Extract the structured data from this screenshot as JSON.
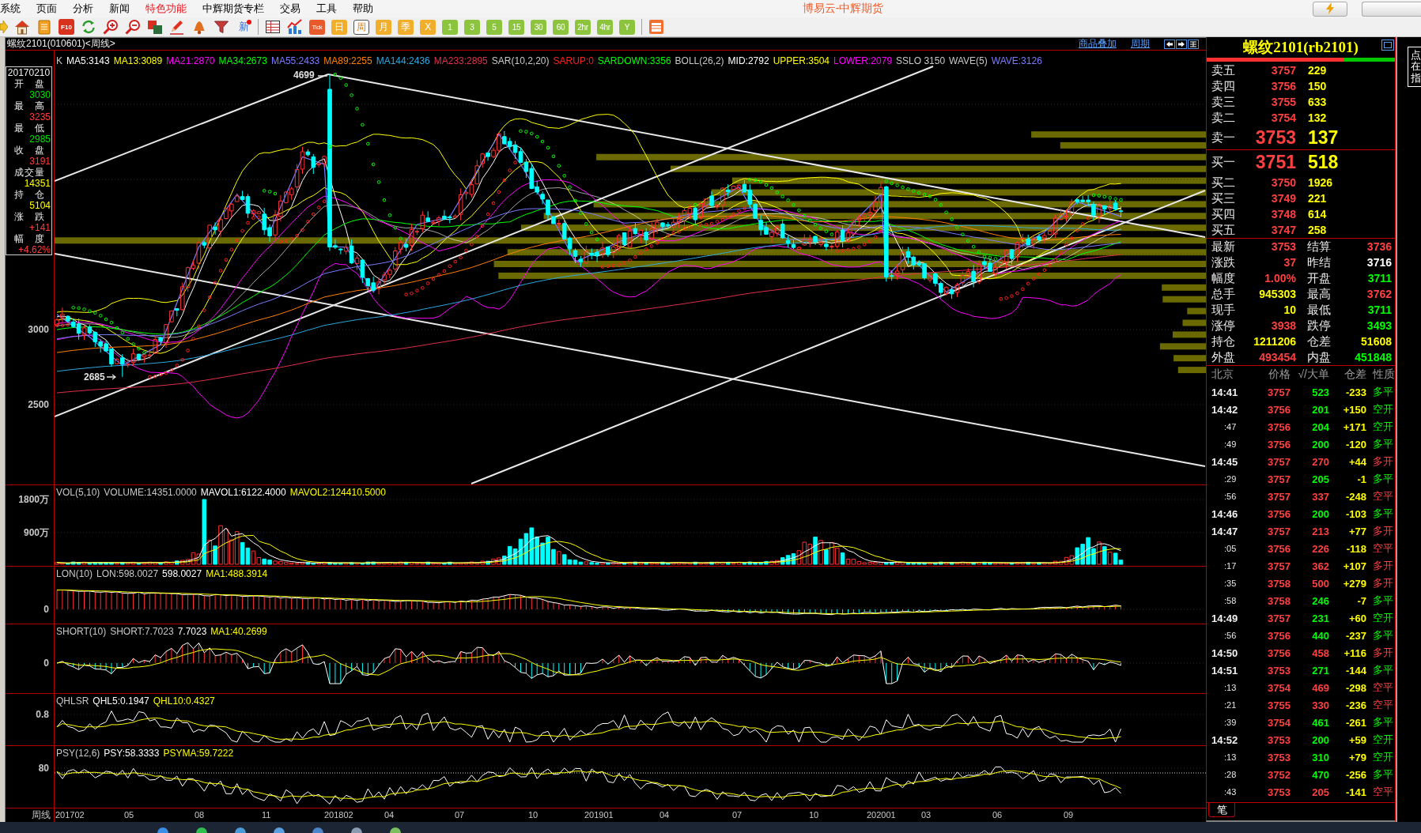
{
  "menu_bar": {
    "items": [
      {
        "label": "系统",
        "highlighted": false
      },
      {
        "label": "页面",
        "highlighted": false
      },
      {
        "label": "分析",
        "highlighted": false
      },
      {
        "label": "新闻",
        "highlighted": false
      },
      {
        "label": "特色功能",
        "highlighted": true
      },
      {
        "label": "中辉期货专栏",
        "highlighted": false
      },
      {
        "label": "交易",
        "highlighted": false
      },
      {
        "label": "工具",
        "highlighted": false
      },
      {
        "label": "帮助",
        "highlighted": false
      }
    ],
    "title": "博易云-中辉期货"
  },
  "toolbar": {
    "f10_label": "F10",
    "news_label": "新",
    "periods": [
      {
        "label": "Tick",
        "kind": "tick",
        "selected": false
      },
      {
        "label": "日",
        "kind": "calendar",
        "selected": false
      },
      {
        "label": "周",
        "kind": "calendar",
        "selected": true
      },
      {
        "label": "月",
        "kind": "calendar",
        "selected": false
      },
      {
        "label": "季",
        "kind": "calendar",
        "selected": false
      },
      {
        "label": "X",
        "kind": "calendar",
        "selected": false
      },
      {
        "label": "1",
        "kind": "minute",
        "selected": false
      },
      {
        "label": "3",
        "kind": "minute",
        "selected": false
      },
      {
        "label": "5",
        "kind": "minute",
        "selected": false
      },
      {
        "label": "15",
        "kind": "minute",
        "selected": false
      },
      {
        "label": "30",
        "kind": "minute",
        "selected": false
      },
      {
        "label": "60",
        "kind": "minute",
        "selected": false
      },
      {
        "label": "2hr",
        "kind": "minute",
        "selected": false
      },
      {
        "label": "4hr",
        "kind": "minute",
        "selected": false
      },
      {
        "label": "Y",
        "kind": "minute",
        "selected": false
      }
    ]
  },
  "chart_header": {
    "title": "螺纹2101(010601)<周线>",
    "links": [
      "商品叠加",
      "周期"
    ]
  },
  "main_chart": {
    "legend": [
      {
        "text": "K",
        "color": "#c8c8c8"
      },
      {
        "text": "MA5:3143",
        "color": "#ffffff"
      },
      {
        "text": "MA13:3089",
        "color": "#ffff00"
      },
      {
        "text": "MA21:2870",
        "color": "#ff00ff"
      },
      {
        "text": "MA34:2673",
        "color": "#00ff00"
      },
      {
        "text": "MA55:2433",
        "color": "#7b7bff"
      },
      {
        "text": "MA89:2255",
        "color": "#ff8000"
      },
      {
        "text": "MA144:2436",
        "color": "#2ea8e0"
      },
      {
        "text": "MA233:2895",
        "color": "#e0304a"
      },
      {
        "text": "SAR(10,2,20)",
        "color": "#c8c8c8"
      },
      {
        "text": "SARUP:0",
        "color": "#ff2020"
      },
      {
        "text": "SARDOWN:3356",
        "color": "#00ff00"
      },
      {
        "text": "BOLL(26,2)",
        "color": "#c8c8c8"
      },
      {
        "text": "MID:2792",
        "color": "#ffffff"
      },
      {
        "text": "UPPER:3504",
        "color": "#ffff00"
      },
      {
        "text": "LOWER:2079",
        "color": "#ff00ff"
      },
      {
        "text": "SSLO 3150",
        "color": "#c8c8c8"
      },
      {
        "text": "WAVE(5)",
        "color": "#c8c8c8"
      },
      {
        "text": "WAVE:3126",
        "color": "#7b7bff"
      }
    ],
    "y_labels": [
      "3000",
      "2500"
    ],
    "high_marker": "4699",
    "low_marker": "2685",
    "info_box": {
      "date": "20170210",
      "rows": [
        {
          "label": "开盘",
          "value": "3030",
          "color": "#00e000"
        },
        {
          "label": "最高",
          "value": "3235",
          "color": "#ff3c3c"
        },
        {
          "label": "最低",
          "value": "2985",
          "color": "#00e000"
        },
        {
          "label": "收盘",
          "value": "3191",
          "color": "#ff3c3c"
        },
        {
          "label": "成交量",
          "value": "14351",
          "color": "#ffff00"
        },
        {
          "label": "持仓",
          "value": "5104",
          "color": "#ffff00"
        },
        {
          "label": "涨跌",
          "value": "+141",
          "color": "#ff3c3c"
        },
        {
          "label": "幅度",
          "value": "+4.62%",
          "color": "#ff3c3c"
        }
      ]
    }
  },
  "indicator_panes": [
    {
      "kind": "volume",
      "legend": [
        {
          "text": "VOL(5,10)",
          "color": "#c8c8c8"
        },
        {
          "text": "VOLUME:14351.0000",
          "color": "#c8c8c8"
        },
        {
          "text": "MAVOL1:6122.4000",
          "color": "#ffffff"
        },
        {
          "text": "MAVOL2:124410.5000",
          "color": "#ffff00"
        }
      ],
      "y_labels": [
        "1800万",
        "900万"
      ]
    },
    {
      "kind": "lon",
      "legend": [
        {
          "text": "LON(10)",
          "color": "#c8c8c8"
        },
        {
          "text": "LON:598.0027",
          "color": "#c8c8c8"
        },
        {
          "text": "598.0027",
          "color": "#ffffff"
        },
        {
          "text": "MA1:488.3914",
          "color": "#ffff00"
        }
      ],
      "y_labels": [
        "0"
      ]
    },
    {
      "kind": "short",
      "legend": [
        {
          "text": "SHORT(10)",
          "color": "#c8c8c8"
        },
        {
          "text": "SHORT:7.7023",
          "color": "#c8c8c8"
        },
        {
          "text": "7.7023",
          "color": "#ffffff"
        },
        {
          "text": "MA1:40.2699",
          "color": "#ffff00"
        }
      ],
      "y_labels": [
        "0"
      ]
    },
    {
      "kind": "qhlsr",
      "legend": [
        {
          "text": "QHLSR",
          "color": "#c8c8c8"
        },
        {
          "text": "QHL5:0.1947",
          "color": "#ffffff"
        },
        {
          "text": "QHL10:0.4327",
          "color": "#ffff00"
        }
      ],
      "y_labels": [
        "0.8"
      ]
    },
    {
      "kind": "psy",
      "legend": [
        {
          "text": "PSY(12,6)",
          "color": "#c8c8c8"
        },
        {
          "text": "PSY:58.3333",
          "color": "#ffffff"
        },
        {
          "text": "PSYMA:59.7222",
          "color": "#ffff00"
        }
      ],
      "y_labels": [
        "80"
      ]
    }
  ],
  "x_axis": {
    "label": "周线",
    "ticks": [
      "201702",
      "05",
      "08",
      "11",
      "201802",
      "04",
      "07",
      "10",
      "201901",
      "04",
      "07",
      "10",
      "202001",
      "03",
      "06",
      "09"
    ]
  },
  "quote_panel": {
    "title": "螺纹2101(rb2101)",
    "ratio_bar": {
      "level": 0.73
    },
    "asks": [
      {
        "label": "卖五",
        "price": "3757",
        "volume": "229",
        "kind": "level"
      },
      {
        "label": "卖四",
        "price": "3756",
        "volume": "150",
        "kind": "level"
      },
      {
        "label": "卖三",
        "price": "3755",
        "volume": "633",
        "kind": "level"
      },
      {
        "label": "卖二",
        "price": "3754",
        "volume": "132",
        "kind": "level"
      },
      {
        "label": "卖一",
        "price": "3753",
        "volume": "137",
        "kind": "best"
      }
    ],
    "bids": [
      {
        "label": "买一",
        "price": "3751",
        "volume": "518",
        "kind": "best"
      },
      {
        "label": "买二",
        "price": "3750",
        "volume": "1926",
        "kind": "level"
      },
      {
        "label": "买三",
        "price": "3749",
        "volume": "221",
        "kind": "level"
      },
      {
        "label": "买四",
        "price": "3748",
        "volume": "614",
        "kind": "level"
      },
      {
        "label": "买五",
        "price": "3747",
        "volume": "258",
        "kind": "level"
      }
    ],
    "stats": [
      {
        "label": "最新",
        "value": "3753",
        "color": "#ff4040"
      },
      {
        "label": "结算",
        "value": "3736",
        "color": "#ff4040"
      },
      {
        "label": "涨跌",
        "value": "37",
        "color": "#ff4040"
      },
      {
        "label": "昨结",
        "value": "3716",
        "color": "#ffffff"
      },
      {
        "label": "幅度",
        "value": "1.00%",
        "color": "#ff4040"
      },
      {
        "label": "开盘",
        "value": "3711",
        "color": "#00ff00"
      },
      {
        "label": "总手",
        "value": "945303",
        "color": "#ffff00"
      },
      {
        "label": "最高",
        "value": "3762",
        "color": "#ff4040"
      },
      {
        "label": "现手",
        "value": "10",
        "color": "#ffff00"
      },
      {
        "label": "最低",
        "value": "3711",
        "color": "#00ff00"
      },
      {
        "label": "涨停",
        "value": "3938",
        "color": "#ff4040"
      },
      {
        "label": "跌停",
        "value": "3493",
        "color": "#00ff00"
      },
      {
        "label": "持仓",
        "value": "1211206",
        "color": "#ffff00"
      },
      {
        "label": "仓差",
        "value": "51608",
        "color": "#ffff00"
      },
      {
        "label": "外盘",
        "value": "493454",
        "color": "#ff4040"
      },
      {
        "label": "内盘",
        "value": "451848",
        "color": "#00ff00"
      }
    ],
    "tick_columns": [
      "北京",
      "价格",
      "√/大单",
      "仓差",
      "性质"
    ],
    "ticks": [
      {
        "time": "14:41",
        "kind": "minute",
        "price": "3757",
        "volume": "523",
        "change": "-233",
        "nature": "多平",
        "color": "#00ff00"
      },
      {
        "time": "14:42",
        "kind": "minute",
        "price": "3756",
        "volume": "201",
        "change": "+150",
        "nature": "空开",
        "color": "#00ff00"
      },
      {
        "time": ":47",
        "kind": "second",
        "price": "3756",
        "volume": "204",
        "change": "+171",
        "nature": "空开",
        "color": "#00ff00"
      },
      {
        "time": ":49",
        "kind": "second",
        "price": "3756",
        "volume": "200",
        "change": "-120",
        "nature": "多平",
        "color": "#00ff00"
      },
      {
        "time": "14:45",
        "kind": "minute",
        "price": "3757",
        "volume": "270",
        "change": "+44",
        "nature": "多开",
        "color": "#ff4040"
      },
      {
        "time": ":29",
        "kind": "second",
        "price": "3757",
        "volume": "205",
        "change": "-1",
        "nature": "多平",
        "color": "#00ff00"
      },
      {
        "time": ":56",
        "kind": "second",
        "price": "3757",
        "volume": "337",
        "change": "-248",
        "nature": "空平",
        "color": "#ff4040"
      },
      {
        "time": "14:46",
        "kind": "minute",
        "price": "3756",
        "volume": "200",
        "change": "-103",
        "nature": "多平",
        "color": "#00ff00"
      },
      {
        "time": "14:47",
        "kind": "minute",
        "price": "3757",
        "volume": "213",
        "change": "+77",
        "nature": "多开",
        "color": "#ff4040"
      },
      {
        "time": ":05",
        "kind": "second",
        "price": "3756",
        "volume": "226",
        "change": "-118",
        "nature": "空平",
        "color": "#ff4040"
      },
      {
        "time": ":17",
        "kind": "second",
        "price": "3757",
        "volume": "362",
        "change": "+107",
        "nature": "多开",
        "color": "#ff4040"
      },
      {
        "time": ":35",
        "kind": "second",
        "price": "3758",
        "volume": "500",
        "change": "+279",
        "nature": "多开",
        "color": "#ff4040"
      },
      {
        "time": ":58",
        "kind": "second",
        "price": "3758",
        "volume": "246",
        "change": "-7",
        "nature": "多平",
        "color": "#00ff00"
      },
      {
        "time": "14:49",
        "kind": "minute",
        "price": "3757",
        "volume": "231",
        "change": "+60",
        "nature": "空开",
        "color": "#00ff00"
      },
      {
        "time": ":56",
        "kind": "second",
        "price": "3756",
        "volume": "440",
        "change": "-237",
        "nature": "多平",
        "color": "#00ff00"
      },
      {
        "time": "14:50",
        "kind": "minute",
        "price": "3756",
        "volume": "458",
        "change": "+116",
        "nature": "多开",
        "color": "#ff4040"
      },
      {
        "time": "14:51",
        "kind": "minute",
        "price": "3753",
        "volume": "271",
        "change": "-144",
        "nature": "多平",
        "color": "#00ff00"
      },
      {
        "time": ":13",
        "kind": "second",
        "price": "3754",
        "volume": "469",
        "change": "-298",
        "nature": "空平",
        "color": "#ff4040"
      },
      {
        "time": ":21",
        "kind": "second",
        "price": "3755",
        "volume": "330",
        "change": "-236",
        "nature": "空平",
        "color": "#ff4040"
      },
      {
        "time": ":39",
        "kind": "second",
        "price": "3754",
        "volume": "461",
        "change": "-261",
        "nature": "多平",
        "color": "#00ff00"
      },
      {
        "time": "14:52",
        "kind": "minute",
        "price": "3753",
        "volume": "200",
        "change": "+59",
        "nature": "空开",
        "color": "#00ff00"
      },
      {
        "time": ":13",
        "kind": "second",
        "price": "3753",
        "volume": "310",
        "change": "+79",
        "nature": "空开",
        "color": "#00ff00"
      },
      {
        "time": ":28",
        "kind": "second",
        "price": "3752",
        "volume": "470",
        "change": "-256",
        "nature": "多平",
        "color": "#00ff00"
      },
      {
        "time": ":43",
        "kind": "second",
        "price": "3753",
        "volume": "205",
        "change": "-141",
        "nature": "空平",
        "color": "#ff4040"
      }
    ],
    "tabs": [
      {
        "label": "笔",
        "selected": true
      }
    ]
  },
  "side_panel": {
    "label": "点在指"
  }
}
